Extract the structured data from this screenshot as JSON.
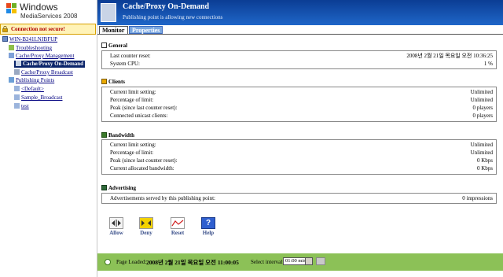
{
  "brand": {
    "word1": "Windows",
    "word2": "MediaServices 2008"
  },
  "warning": {
    "text": "Connection not secure!"
  },
  "tree": [
    {
      "label": "WIN-B241LNJBFUP"
    },
    {
      "label": "Troubleshooting"
    },
    {
      "label": "Cache/Proxy Management"
    },
    {
      "label": "Cache/Proxy On-Demand"
    },
    {
      "label": "Cache/Proxy Broadcast"
    },
    {
      "label": "Publishing Points"
    },
    {
      "label": "<Default>"
    },
    {
      "label": "Sample_Broadcast"
    },
    {
      "label": "test"
    }
  ],
  "header": {
    "title": "Cache/Proxy On-Demand",
    "subtitle": "Publishing point is allowing new connections"
  },
  "tabs": {
    "monitor": "Monitor",
    "properties": "Properties"
  },
  "general": {
    "title": "General",
    "rows": [
      {
        "k": "Last counter reset:",
        "v": "2008년 2월 21일 목요일 오전 10:36:25"
      },
      {
        "k": "System CPU:",
        "v": "1 %"
      }
    ]
  },
  "clients": {
    "title": "Clients",
    "rows": [
      {
        "k": "Current limit setting:",
        "v": "Unlimited"
      },
      {
        "k": "Percentage of limit:",
        "v": "Unlimited"
      },
      {
        "k": "Peak (since last counter reset):",
        "v": "0 players"
      },
      {
        "k": "Connected unicast clients:",
        "v": "0 players"
      }
    ]
  },
  "bandwidth": {
    "title": "Bandwidth",
    "rows": [
      {
        "k": "Current limit setting:",
        "v": "Unlimited"
      },
      {
        "k": "Percentage of limit:",
        "v": "Unlimited"
      },
      {
        "k": "Peak (since last counter reset):",
        "v": "0 Kbps"
      },
      {
        "k": "Current allocated bandwidth:",
        "v": "0 Kbps"
      }
    ]
  },
  "advertising": {
    "title": "Advertising",
    "rows": [
      {
        "k": "Advertisements served by this publishing point:",
        "v": "0 impressions"
      }
    ]
  },
  "actions": {
    "allow": "Allow",
    "deny": "Deny",
    "reset": "Reset",
    "help": "Help"
  },
  "footer": {
    "page_loaded_label": "Page Loaded:",
    "page_loaded_time": "2008년 2월 21일 목요일 오전 11:00:05",
    "interval_label": "Select interval:",
    "interval_value": "01:00 min"
  },
  "colors": {
    "header": "#1f66c8",
    "footer": "#8cc157",
    "selected": "#0a246a",
    "warning_text": "#b00000"
  }
}
